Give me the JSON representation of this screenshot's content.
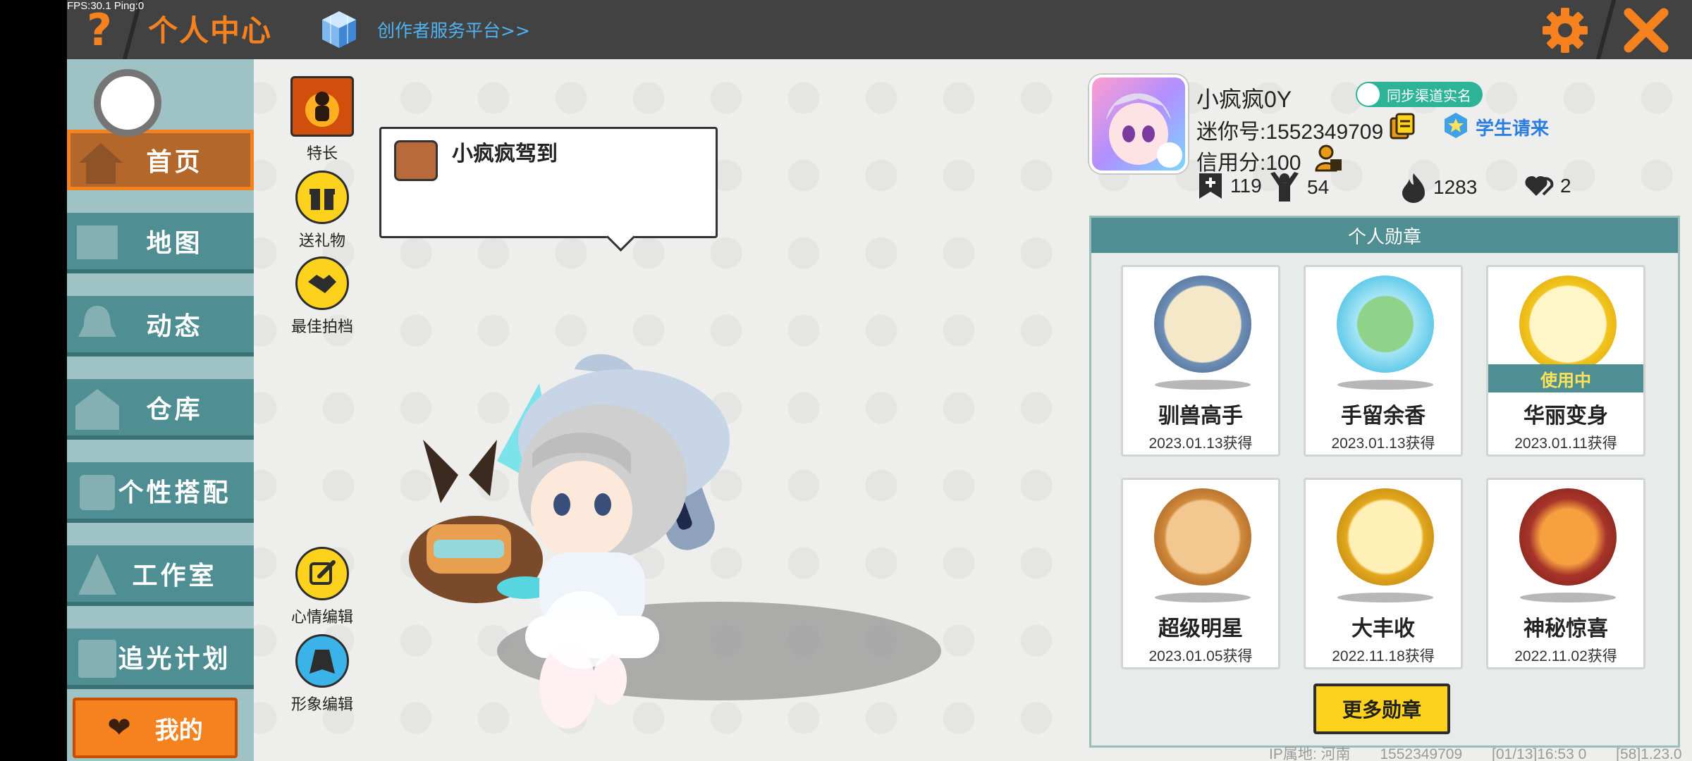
{
  "debug": "FPS:30.1  Ping:0",
  "header": {
    "title": "个人中心",
    "creator_link": "创作者服务平台>>"
  },
  "sidebar": {
    "items": [
      {
        "label": "首页",
        "icon": "house-icon",
        "active": true
      },
      {
        "label": "地图",
        "icon": "map-icon"
      },
      {
        "label": "动态",
        "icon": "bell-icon"
      },
      {
        "label": "仓库",
        "icon": "warehouse-icon"
      },
      {
        "label": "个性搭配",
        "icon": "outfit-icon"
      },
      {
        "label": "工作室",
        "icon": "studio-icon"
      },
      {
        "label": "追光计划",
        "icon": "spotlight-icon"
      }
    ],
    "mine_label": "我的"
  },
  "actions": {
    "specialty": "特长",
    "gift": "送礼物",
    "partner": "最佳拍档",
    "mood_edit": "心情编辑",
    "avatar_edit": "形象编辑"
  },
  "bubble": {
    "text": "小疯疯驾到"
  },
  "profile": {
    "nickname": "小疯疯0Y",
    "verify_label": "同步渠道实名",
    "mini_id": "迷你号:1552349709",
    "student_label": "学生请来",
    "credit": "信用分:100",
    "stats": {
      "friends": "119",
      "fans": "54",
      "heat": "1283",
      "likes": "2"
    }
  },
  "medals": {
    "title": "个人勋章",
    "in_use_label": "使用中",
    "items": [
      {
        "name": "驯兽高手",
        "date": "2023.01.13获得",
        "color": "#6d8fb8"
      },
      {
        "name": "手留余香",
        "date": "2023.01.13获得",
        "color": "#58c6e6"
      },
      {
        "name": "华丽变身",
        "date": "2023.01.11获得",
        "color": "#f2c51d",
        "in_use": true
      },
      {
        "name": "超级明星",
        "date": "2023.01.05获得",
        "color": "#d18a3a"
      },
      {
        "name": "大丰收",
        "date": "2022.11.18获得",
        "color": "#e3a81d"
      },
      {
        "name": "神秘惊喜",
        "date": "2022.11.02获得",
        "color": "#a8342a"
      }
    ],
    "more_label": "更多勋章"
  },
  "footer": {
    "ip": "IP属地: 河南",
    "uid": "1552349709",
    "time": "[01/13]16:53 0",
    "version": "[58]1.23.0"
  },
  "colors": {
    "accent": "#f5821f",
    "teal": "#4f8e92",
    "yellow": "#fcd21c",
    "link": "#4fb3f2"
  }
}
